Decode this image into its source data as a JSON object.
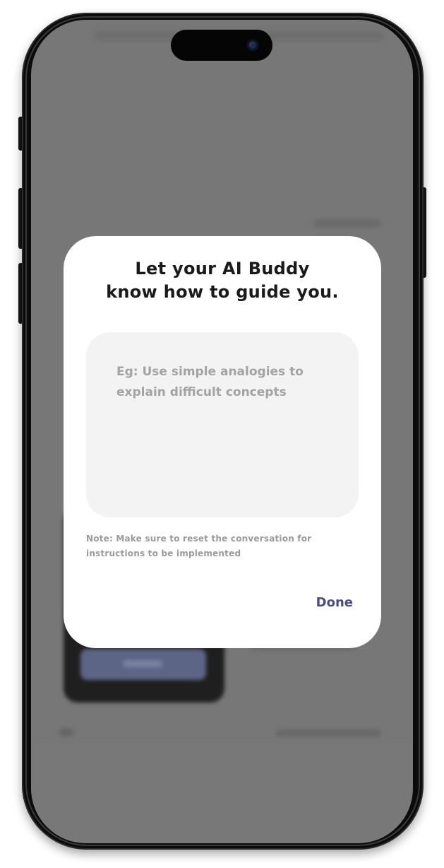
{
  "modal": {
    "title_line1": "Let your AI Buddy",
    "title_line2": "know how to guide you.",
    "instruction_input": {
      "value": "",
      "placeholder": "Eg: Use simple analogies to explain difficult concepts"
    },
    "note": "Note: Make sure to reset the conversation for instructions to be implemented",
    "done_label": "Done"
  },
  "colors": {
    "accent": "#4b4d7f",
    "overlay": "#777777",
    "modal_background": "#ffffff",
    "input_background": "#f3f3f3"
  }
}
